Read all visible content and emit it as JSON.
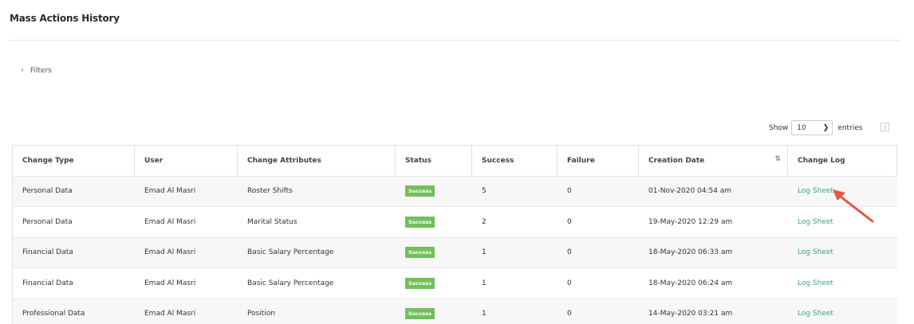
{
  "page": {
    "title": "Mass Actions History"
  },
  "filters": {
    "label": "Filters",
    "icon": "chevron-right-icon"
  },
  "length_control": {
    "show_label": "Show",
    "selected": "10",
    "entries_label": "entries"
  },
  "export": {
    "icon": "download-icon"
  },
  "table": {
    "columns": [
      "Change Type",
      "User",
      "Change Attributes",
      "Status",
      "Success",
      "Failure",
      "Creation Date",
      "Change Log"
    ],
    "sorted_column": "Creation Date",
    "rows": [
      {
        "change_type": "Personal Data",
        "user": "Emad Al Masri",
        "attributes": "Roster Shifts",
        "status": "Success",
        "success": "5",
        "failure": "0",
        "date": "01-Nov-2020 04:54 am",
        "log": "Log Sheet"
      },
      {
        "change_type": "Personal Data",
        "user": "Emad Al Masri",
        "attributes": "Marital Status",
        "status": "Success",
        "success": "2",
        "failure": "0",
        "date": "19-May-2020 12:29 am",
        "log": "Log Sheet"
      },
      {
        "change_type": "Financial Data",
        "user": "Emad Al Masri",
        "attributes": "Basic Salary Percentage",
        "status": "Success",
        "success": "1",
        "failure": "0",
        "date": "18-May-2020 06:33 am",
        "log": "Log Sheet"
      },
      {
        "change_type": "Financial Data",
        "user": "Emad Al Masri",
        "attributes": "Basic Salary Percentage",
        "status": "Success",
        "success": "1",
        "failure": "0",
        "date": "18-May-2020 06:24 am",
        "log": "Log Sheet"
      },
      {
        "change_type": "Professional Data",
        "user": "Emad Al Masri",
        "attributes": "Position",
        "status": "Success",
        "success": "1",
        "failure": "0",
        "date": "14-May-2020 03:21 am",
        "log": "Log Sheet"
      }
    ]
  },
  "annotation": {
    "icon": "red-arrow-icon",
    "color": "#e8553e"
  },
  "colors": {
    "success_badge": "#71c05a",
    "link": "#3aa391"
  }
}
